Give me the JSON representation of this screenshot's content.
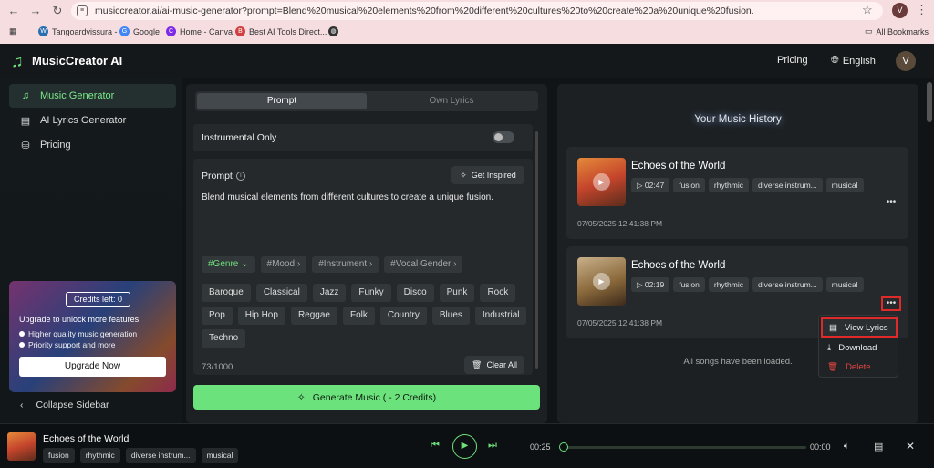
{
  "browser": {
    "url": "musiccreator.ai/ai-music-generator?prompt=Blend%20musical%20elements%20from%20different%20cultures%20to%20create%20a%20unique%20fusion.",
    "profile_initial": "V",
    "bookmarks": [
      "Tangoardvissura -",
      "Google",
      "Home - Canva",
      "Best AI Tools Direct..."
    ],
    "all_bookmarks": "All Bookmarks"
  },
  "header": {
    "app_name": "MusicCreator AI",
    "pricing": "Pricing",
    "language": "English",
    "avatar_initial": "V"
  },
  "sidebar": {
    "items": [
      {
        "label": "Music Generator",
        "icon": "music-note-icon"
      },
      {
        "label": "AI Lyrics Generator",
        "icon": "document-icon"
      },
      {
        "label": "Pricing",
        "icon": "database-icon"
      }
    ],
    "promo": {
      "credits": "Credits left: 0",
      "title": "Upgrade to unlock more features",
      "benefits": [
        "Higher quality music generation",
        "Priority support and more"
      ],
      "button": "Upgrade Now"
    },
    "collapse": "Collapse Sidebar"
  },
  "prompt_panel": {
    "tabs": [
      "Prompt",
      "Own Lyrics"
    ],
    "instrumental_label": "Instrumental Only",
    "prompt_label": "Prompt",
    "get_inspired": "Get Inspired",
    "prompt_text": "Blend musical elements from different cultures to create a unique fusion.",
    "filters": [
      "#Genre",
      "#Mood",
      "#Instrument",
      "#Vocal Gender"
    ],
    "genres": [
      "Baroque",
      "Classical",
      "Jazz",
      "Funky",
      "Disco",
      "Punk",
      "Rock",
      "Pop",
      "Hip Hop",
      "Reggae",
      "Folk",
      "Country",
      "Blues",
      "Industrial",
      "Techno"
    ],
    "char_count": "73/1000",
    "clear_all": "Clear All",
    "generate": "Generate Music ( - 2 Credits)"
  },
  "history": {
    "title": "Your Music History",
    "songs": [
      {
        "title": "Echoes of the World",
        "duration": "02:47",
        "tags": [
          "fusion",
          "rhythmic",
          "diverse instrum...",
          "musical"
        ],
        "date": "07/05/2025 12:41:38 PM"
      },
      {
        "title": "Echoes of the World",
        "duration": "02:19",
        "tags": [
          "fusion",
          "rhythmic",
          "diverse instrum...",
          "musical"
        ],
        "date": "07/05/2025 12:41:38 PM"
      }
    ],
    "menu": [
      "View Lyrics",
      "Download",
      "Delete"
    ],
    "loaded_msg": "All songs have been loaded."
  },
  "player": {
    "title": "Echoes of the World",
    "tags": [
      "fusion",
      "rhythmic",
      "diverse instrum...",
      "musical"
    ],
    "elapsed": "00:25",
    "remaining": "00:00"
  },
  "colors": {
    "accent": "#6ce27c",
    "highlight": "#e02a2a",
    "danger": "#e0453f"
  }
}
